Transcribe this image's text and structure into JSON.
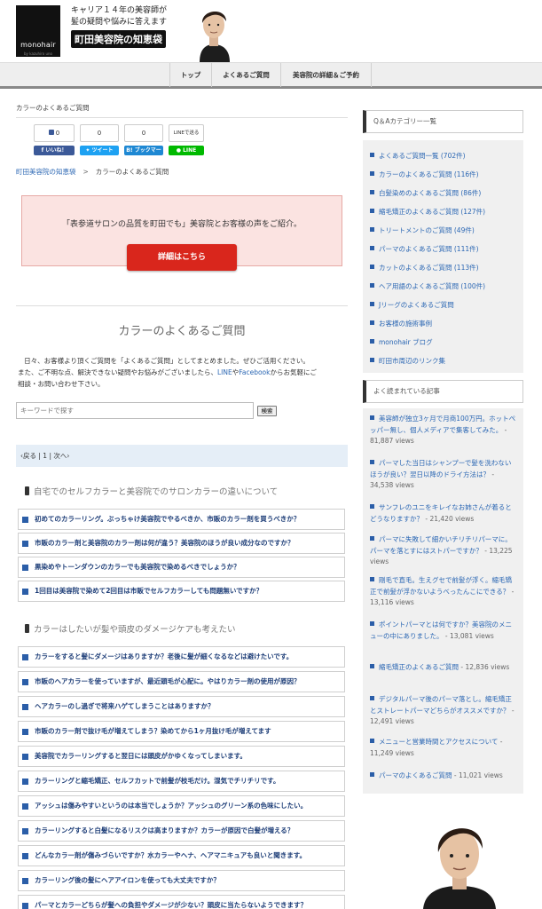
{
  "header": {
    "tagline_line1": "キャリア１４年の美容師が",
    "tagline_line2": "髪の疑問や悩みに答えます",
    "brand_title": "町田美容院の知恵袋",
    "logo_text": "monohair",
    "logo_sub": "by kazuhiro uno"
  },
  "nav": {
    "items": [
      "トップ",
      "よくあるご質問",
      "美容院の詳細＆ご予約"
    ]
  },
  "main": {
    "crumb_top": "カラーのよくあるご質問",
    "share": {
      "like_count": "0",
      "tweet_count": "0",
      "bookmark_count": "0",
      "line_send": "LINEで送る",
      "fb_label": "いいね！",
      "tw_label": "ツイート",
      "hb_label": "ブックマーク",
      "line_label": "LINE"
    },
    "breadcrumb": {
      "home": "町田美容院の知恵袋",
      "sep": ">",
      "current": "カラーのよくあるご質問"
    },
    "promo": {
      "text": "「表参道サロンの品質を町田でも」美容院とお客様の声をご紹介。",
      "button": "詳細はこちら"
    },
    "page_title": "カラーのよくあるご質問",
    "intro_1": "日々、お客様より頂くご質問を「よくあるご質問」としてまとめました。ぜひご活用ください。",
    "intro_2a": "また、ご不明な点、解決できない疑問やお悩みがございましたら、",
    "intro_line": "LINE",
    "intro_or": "や",
    "intro_fb": "Facebook",
    "intro_2b": "からお気軽にご",
    "intro_3": "相談・お問い合わせ下さい。",
    "search": {
      "placeholder": "キーワードで探す",
      "button": "検索"
    },
    "pager": "‹戻る | 1 | 次へ›",
    "categories": [
      {
        "heading": "自宅でのセルフカラーと美容院でのサロンカラーの違いについて",
        "questions": [
          "初めてのカラーリング。ぶっちゃけ美容院でやるべきか、市販のカラー剤を買うべきか？",
          "市販のカラー剤と美容院のカラー剤は何が違う？美容院のほうが良い成分なのですか？",
          "黒染めやトーンダウンのカラーでも美容院で染めるべきでしょうか？",
          "1回目は美容院で染めて2回目は市販でセルフカラーしても問題無いですか？"
        ]
      },
      {
        "heading": "カラーはしたいが髪や頭皮のダメージケアも考えたい",
        "questions": [
          "カラーをすると髪にダメージはありますか？老後に髪が細くなるなどは避けたいです。",
          "市販のヘアカラーを使っていますが、最近頭毛が心配に。やはりカラー剤の使用が原因？",
          "ヘアカラーのし過ぎで将来ハゲてしまうことはありますか？",
          "市販のカラー剤で抜け毛が増えてしまう？染めてから1ヶ月抜け毛が増えてます",
          "美容院でカラーリングすると翌日には頭皮がかゆくなってしまいます。",
          "カラーリングと縮毛矯正、セルフカットで前髪が枝毛だけ。湿気でチリチリです。",
          "アッシュは傷みやすいというのは本当でしょうか？アッシュのグリーン系の色味にしたい。",
          "カラーリングすると白髪になるリスクは高まりますか？カラーが原因で白髪が増える？",
          "どんなカラー剤が傷みづらいですか？水カラーやヘナ、ヘアマニキュアも良いと聞きます。",
          "カラーリング後の髪にヘアアイロンを使っても大丈夫ですか？",
          "パーマとカラーどちらが髪への負担やダメージが少ない？頭皮に当たらないようできます？"
        ]
      }
    ]
  },
  "sidebar": {
    "cat_heading": "Q＆Aカテゴリー一覧",
    "categories": [
      "よくあるご質問一覧 (702件)",
      "カラーのよくあるご質問 (116件)",
      "白髪染めのよくあるご質問 (86件)",
      "縮毛矯正のよくあるご質問 (127件)",
      "トリートメントのご質問 (49件)",
      "パーマのよくあるご質問 (111件)",
      "カットのよくあるご質問 (113件)",
      "ヘア用語のよくあるご質問 (100件)",
      "Jリーグのよくあるご質問",
      "お客様の施術事例",
      "monohair ブログ",
      "町田市周辺のリンク集"
    ],
    "pop_heading": "よく読まれている記事",
    "articles": [
      {
        "title": "美容師が独立3ヶ月で月商100万円。ホットペッパー無し、個人メディアで集客してみた。",
        "views": "81,887 views"
      },
      {
        "title": "パーマした当日はシャンプーで髪を洗わないほうが良い？翌日以降のドライ方法は？",
        "views": "34,538 views"
      },
      {
        "title": "サンフレのユニをキレイなお姉さんが着るとどうなりますか？",
        "views": "21,420 views"
      },
      {
        "title": "パーマに失敗して細かいチリチリパーマに。パーマを落とすにはストパーですか？",
        "views": "13,225 views"
      },
      {
        "title": "剛毛で直毛。生えグセで前髪が浮く。縮毛矯正で前髪が浮かないようべったんこにできる？",
        "views": "13,116 views"
      },
      {
        "title": "ポイントパーマとは何ですか？美容院のメニューの中にありました。",
        "views": "13,081 views"
      },
      {
        "title": "縮毛矯正のよくあるご質問",
        "views": "12,836 views"
      },
      {
        "title": "デジタルパーマ後のパーマ落とし。縮毛矯正とストレートパーマどちらがオススメですか？",
        "views": "12,491 views"
      },
      {
        "title": "メニューと営業時間とアクセスについて",
        "views": "11,249 views"
      },
      {
        "title": "パーマのよくあるご質問",
        "views": "11,021 views"
      }
    ],
    "dash": " - "
  },
  "colors": {
    "nav_bg": "#eeeeee",
    "accent_blue": "#2b5ea8",
    "link_blue": "#2a66b3",
    "promo_bg": "#fbe3e1",
    "promo_btn": "#d9261c",
    "pager_bg": "#e5eef7",
    "facebook": "#3b5998",
    "twitter": "#1da1f2",
    "hatena": "#1e88d3",
    "line": "#00b900"
  },
  "icons": {
    "like": "thumbs-up-icon",
    "category_bullet": "square-bullet-icon",
    "heading_marker": "phone-icon"
  }
}
